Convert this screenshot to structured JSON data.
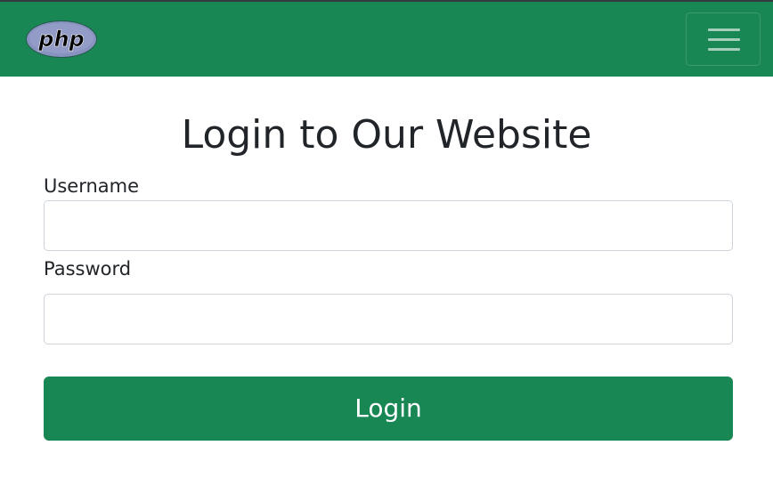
{
  "navbar": {
    "brand_text": "php",
    "brand_color": "#8892bf",
    "background_color": "#198754",
    "menu_icon": "hamburger-icon"
  },
  "login_form": {
    "title": "Login to Our Website",
    "username_label": "Username",
    "username_value": "",
    "password_label": "Password",
    "password_value": "",
    "submit_label": "Login",
    "button_color": "#198754"
  }
}
